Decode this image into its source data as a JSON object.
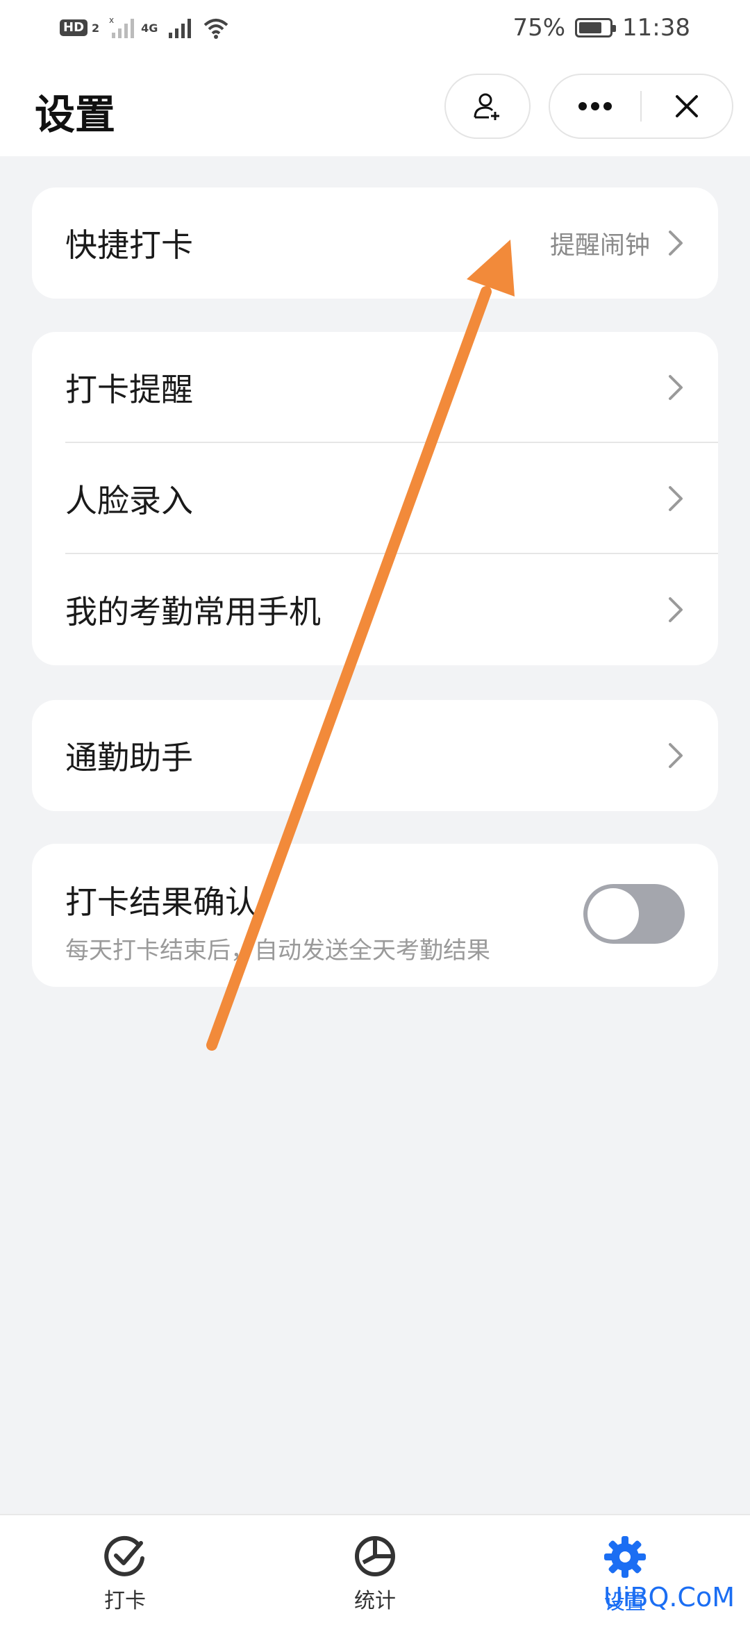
{
  "status_bar": {
    "hd_badge": "HD",
    "sim_slot": "2",
    "network_label": "4G",
    "battery_percent": "75%",
    "battery_level": 0.75,
    "time": "11:38"
  },
  "header": {
    "title": "设置"
  },
  "settings": {
    "quick_punch": {
      "label": "快捷打卡",
      "value": "提醒闹钟"
    },
    "group_rows": [
      {
        "label": "打卡提醒"
      },
      {
        "label": "人脸录入"
      },
      {
        "label": "我的考勤常用手机"
      }
    ],
    "commute_helper": {
      "label": "通勤助手"
    },
    "punch_confirm": {
      "label": "打卡结果确认",
      "description": "每天打卡结束后，自动发送全天考勤结果",
      "enabled": false
    }
  },
  "bottom_nav": {
    "items": [
      {
        "label": "打卡",
        "icon": "check-circle-icon",
        "active": false
      },
      {
        "label": "统计",
        "icon": "pie-chart-icon",
        "active": false
      },
      {
        "label": "设置",
        "icon": "gear-icon",
        "active": true
      }
    ]
  },
  "watermark": "UiBQ.CoM",
  "colors": {
    "accent": "#1b6ef3",
    "annotation_arrow": "#f28a3a",
    "toggle_off": "#a4a6ad"
  }
}
